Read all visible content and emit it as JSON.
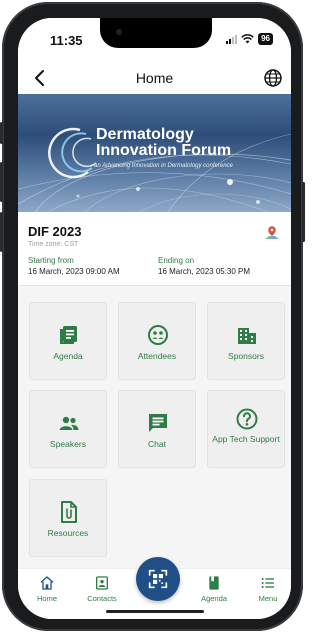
{
  "status_bar": {
    "time": "11:35",
    "battery": "96"
  },
  "header": {
    "title": "Home"
  },
  "banner": {
    "title_line1": "Dermatology",
    "title_line2": "Innovation Forum",
    "subtitle": "an Advancing Innovation in Dermatology conference"
  },
  "event": {
    "name": "DIF 2023",
    "timezone": "Time zone: CST",
    "start_label": "Starting from",
    "start_value": "16 March, 2023   09:00 AM",
    "end_label": "Ending on",
    "end_value": "16 March, 2023   05:30 PM"
  },
  "tiles": [
    {
      "label": "Agenda",
      "icon": "agenda-icon"
    },
    {
      "label": "Attendees",
      "icon": "attendees-icon"
    },
    {
      "label": "Sponsors",
      "icon": "sponsors-icon"
    },
    {
      "label": "Speakers",
      "icon": "speakers-icon"
    },
    {
      "label": "Chat",
      "icon": "chat-icon"
    },
    {
      "label": "App Tech Support",
      "icon": "help-icon"
    },
    {
      "label": "Resources",
      "icon": "resources-icon"
    }
  ],
  "bottom_nav": [
    {
      "label": "Home",
      "icon": "home-icon"
    },
    {
      "label": "Contacts",
      "icon": "contacts-icon"
    },
    {
      "label": "",
      "icon": "qr-scan-icon"
    },
    {
      "label": "Agenda",
      "icon": "book-icon"
    },
    {
      "label": "Menu",
      "icon": "menu-icon"
    }
  ],
  "colors": {
    "accent": "#2f7d44",
    "scan_button": "#1f4f86",
    "tile_bg": "#efefef"
  }
}
